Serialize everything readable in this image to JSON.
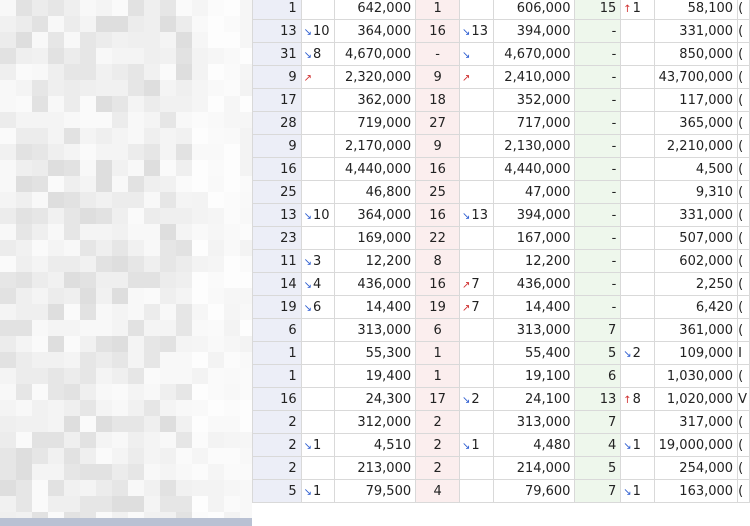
{
  "rows": [
    {
      "r1": "1",
      "m1": "",
      "v1": "642,000",
      "r2": "1",
      "m2": "",
      "v2": "606,000",
      "r3": "15",
      "m3": "↑1",
      "v3": "58,100",
      "t": "("
    },
    {
      "r1": "13",
      "m1": "↘10",
      "v1": "364,000",
      "r2": "16",
      "m2": "↘13",
      "v2": "394,000",
      "r3": "-",
      "m3": "",
      "v3": "331,000",
      "t": "("
    },
    {
      "r1": "31",
      "m1": "↘8",
      "v1": "4,670,000",
      "r2": "-",
      "m2": "↘",
      "v2": "4,670,000",
      "r3": "-",
      "m3": "",
      "v3": "850,000",
      "t": "("
    },
    {
      "r1": "9",
      "m1": "↗",
      "v1": "2,320,000",
      "r2": "9",
      "m2": "↗",
      "v2": "2,410,000",
      "r3": "-",
      "m3": "",
      "v3": "43,700,000",
      "t": "("
    },
    {
      "r1": "17",
      "m1": "",
      "v1": "362,000",
      "r2": "18",
      "m2": "",
      "v2": "352,000",
      "r3": "-",
      "m3": "",
      "v3": "117,000",
      "t": "("
    },
    {
      "r1": "28",
      "m1": "",
      "v1": "719,000",
      "r2": "27",
      "m2": "",
      "v2": "717,000",
      "r3": "-",
      "m3": "",
      "v3": "365,000",
      "t": "("
    },
    {
      "r1": "9",
      "m1": "",
      "v1": "2,170,000",
      "r2": "9",
      "m2": "",
      "v2": "2,130,000",
      "r3": "-",
      "m3": "",
      "v3": "2,210,000",
      "t": "("
    },
    {
      "r1": "16",
      "m1": "",
      "v1": "4,440,000",
      "r2": "16",
      "m2": "",
      "v2": "4,440,000",
      "r3": "-",
      "m3": "",
      "v3": "4,500",
      "t": "("
    },
    {
      "r1": "25",
      "m1": "",
      "v1": "46,800",
      "r2": "25",
      "m2": "",
      "v2": "47,000",
      "r3": "-",
      "m3": "",
      "v3": "9,310",
      "t": "("
    },
    {
      "r1": "13",
      "m1": "↘10",
      "v1": "364,000",
      "r2": "16",
      "m2": "↘13",
      "v2": "394,000",
      "r3": "-",
      "m3": "",
      "v3": "331,000",
      "t": "("
    },
    {
      "r1": "23",
      "m1": "",
      "v1": "169,000",
      "r2": "22",
      "m2": "",
      "v2": "167,000",
      "r3": "-",
      "m3": "",
      "v3": "507,000",
      "t": "("
    },
    {
      "r1": "11",
      "m1": "↘3",
      "v1": "12,200",
      "r2": "8",
      "m2": "",
      "v2": "12,200",
      "r3": "-",
      "m3": "",
      "v3": "602,000",
      "t": "("
    },
    {
      "r1": "14",
      "m1": "↘4",
      "v1": "436,000",
      "r2": "16",
      "m2": "↗7",
      "v2": "436,000",
      "r3": "-",
      "m3": "",
      "v3": "2,250",
      "t": "("
    },
    {
      "r1": "19",
      "m1": "↘6",
      "v1": "14,400",
      "r2": "19",
      "m2": "↗7",
      "v2": "14,400",
      "r3": "-",
      "m3": "",
      "v3": "6,420",
      "t": "("
    },
    {
      "r1": "6",
      "m1": "",
      "v1": "313,000",
      "r2": "6",
      "m2": "",
      "v2": "313,000",
      "r3": "7",
      "m3": "",
      "v3": "361,000",
      "t": "("
    },
    {
      "r1": "1",
      "m1": "",
      "v1": "55,300",
      "r2": "1",
      "m2": "",
      "v2": "55,400",
      "r3": "5",
      "m3": "↘2",
      "v3": "109,000",
      "t": "I"
    },
    {
      "r1": "1",
      "m1": "",
      "v1": "19,400",
      "r2": "1",
      "m2": "",
      "v2": "19,100",
      "r3": "6",
      "m3": "",
      "v3": "1,030,000",
      "t": "("
    },
    {
      "r1": "16",
      "m1": "",
      "v1": "24,300",
      "r2": "17",
      "m2": "↘2",
      "v2": "24,100",
      "r3": "13",
      "m3": "↑8",
      "v3": "1,020,000",
      "t": "V"
    },
    {
      "r1": "2",
      "m1": "",
      "v1": "312,000",
      "r2": "2",
      "m2": "",
      "v2": "313,000",
      "r3": "7",
      "m3": "",
      "v3": "317,000",
      "t": "("
    },
    {
      "r1": "2",
      "m1": "↘1",
      "v1": "4,510",
      "r2": "2",
      "m2": "↘1",
      "v2": "4,480",
      "r3": "4",
      "m3": "↘1",
      "v3": "19,000,000",
      "t": "("
    },
    {
      "r1": "2",
      "m1": "",
      "v1": "213,000",
      "r2": "2",
      "m2": "",
      "v2": "214,000",
      "r3": "5",
      "m3": "",
      "v3": "254,000",
      "t": "("
    },
    {
      "r1": "5",
      "m1": "↘1",
      "v1": "79,500",
      "r2": "4",
      "m2": "",
      "v2": "79,600",
      "r3": "7",
      "m3": "↘1",
      "v3": "163,000",
      "t": "("
    }
  ]
}
